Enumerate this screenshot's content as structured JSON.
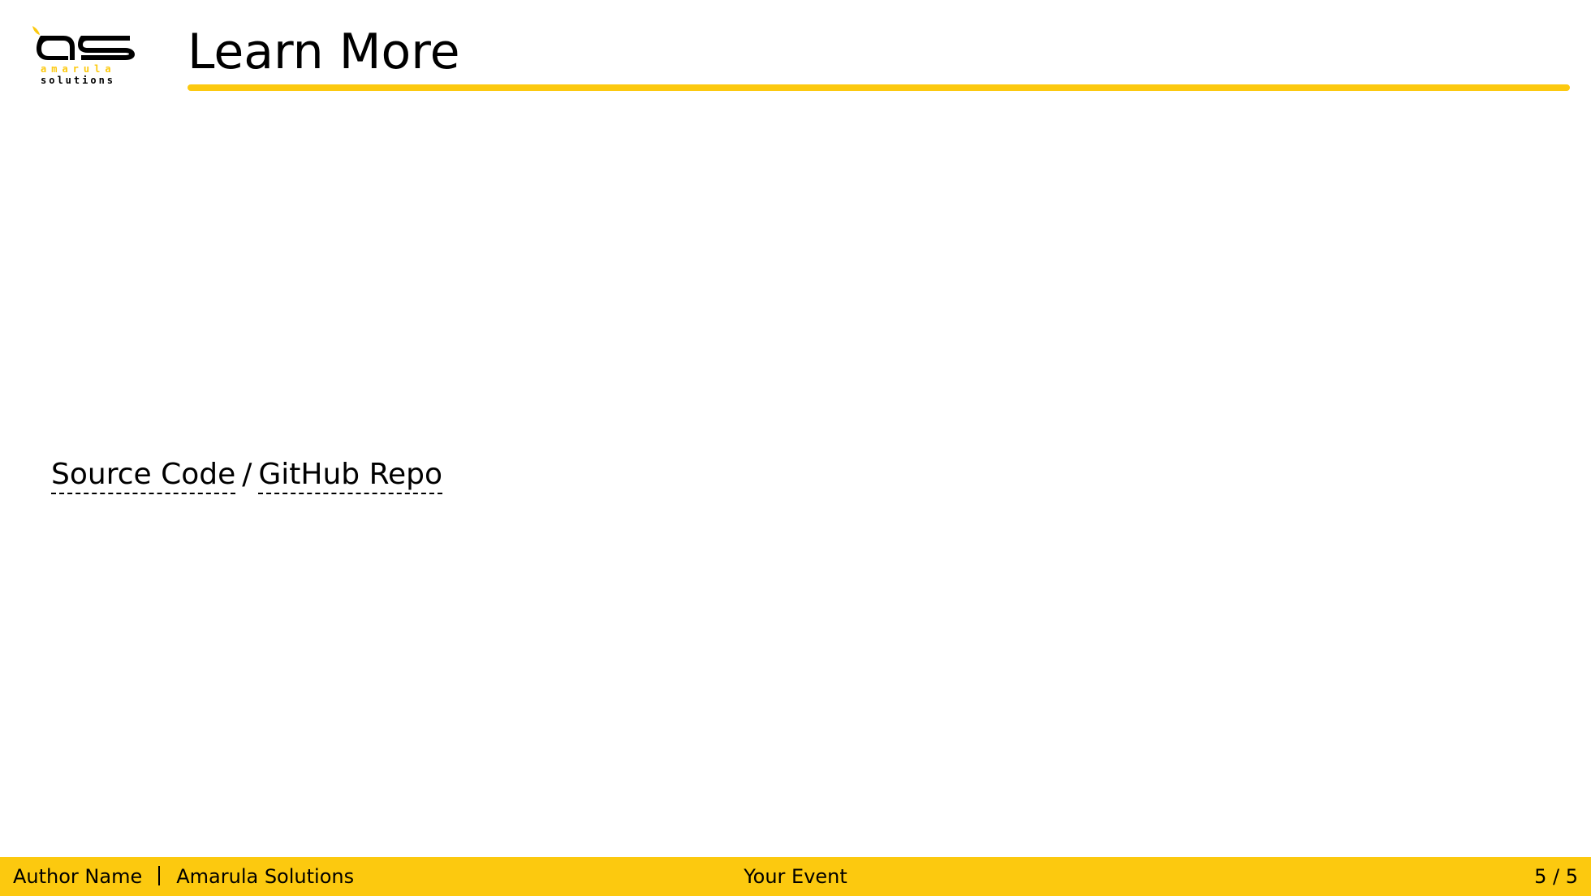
{
  "theme": {
    "accent": "#fcc90f",
    "text": "#000000",
    "background": "#ffffff"
  },
  "logo": {
    "name": "amarula-solutions-logo",
    "line1": "amarula",
    "line2": "solutions"
  },
  "slide": {
    "title": "Learn More"
  },
  "links": {
    "source_code": "Source Code",
    "separator": "/",
    "github_repo": "GitHub Repo"
  },
  "footer": {
    "author": "Author Name",
    "company": "Amarula Solutions",
    "event": "Your Event",
    "page": "5 / 5"
  }
}
